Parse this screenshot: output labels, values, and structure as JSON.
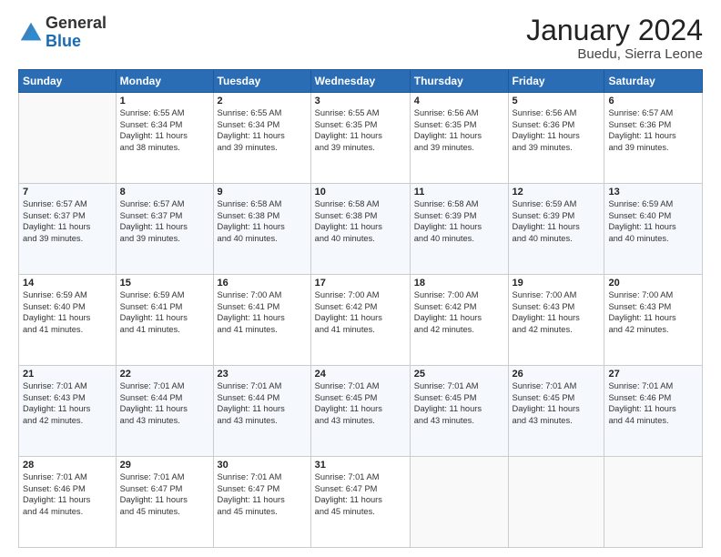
{
  "header": {
    "logo_general": "General",
    "logo_blue": "Blue",
    "title": "January 2024",
    "location": "Buedu, Sierra Leone"
  },
  "calendar": {
    "days_of_week": [
      "Sunday",
      "Monday",
      "Tuesday",
      "Wednesday",
      "Thursday",
      "Friday",
      "Saturday"
    ],
    "weeks": [
      [
        {
          "day": "",
          "info": ""
        },
        {
          "day": "1",
          "info": "Sunrise: 6:55 AM\nSunset: 6:34 PM\nDaylight: 11 hours\nand 38 minutes."
        },
        {
          "day": "2",
          "info": "Sunrise: 6:55 AM\nSunset: 6:34 PM\nDaylight: 11 hours\nand 39 minutes."
        },
        {
          "day": "3",
          "info": "Sunrise: 6:55 AM\nSunset: 6:35 PM\nDaylight: 11 hours\nand 39 minutes."
        },
        {
          "day": "4",
          "info": "Sunrise: 6:56 AM\nSunset: 6:35 PM\nDaylight: 11 hours\nand 39 minutes."
        },
        {
          "day": "5",
          "info": "Sunrise: 6:56 AM\nSunset: 6:36 PM\nDaylight: 11 hours\nand 39 minutes."
        },
        {
          "day": "6",
          "info": "Sunrise: 6:57 AM\nSunset: 6:36 PM\nDaylight: 11 hours\nand 39 minutes."
        }
      ],
      [
        {
          "day": "7",
          "info": "Sunrise: 6:57 AM\nSunset: 6:37 PM\nDaylight: 11 hours\nand 39 minutes."
        },
        {
          "day": "8",
          "info": "Sunrise: 6:57 AM\nSunset: 6:37 PM\nDaylight: 11 hours\nand 39 minutes."
        },
        {
          "day": "9",
          "info": "Sunrise: 6:58 AM\nSunset: 6:38 PM\nDaylight: 11 hours\nand 40 minutes."
        },
        {
          "day": "10",
          "info": "Sunrise: 6:58 AM\nSunset: 6:38 PM\nDaylight: 11 hours\nand 40 minutes."
        },
        {
          "day": "11",
          "info": "Sunrise: 6:58 AM\nSunset: 6:39 PM\nDaylight: 11 hours\nand 40 minutes."
        },
        {
          "day": "12",
          "info": "Sunrise: 6:59 AM\nSunset: 6:39 PM\nDaylight: 11 hours\nand 40 minutes."
        },
        {
          "day": "13",
          "info": "Sunrise: 6:59 AM\nSunset: 6:40 PM\nDaylight: 11 hours\nand 40 minutes."
        }
      ],
      [
        {
          "day": "14",
          "info": "Sunrise: 6:59 AM\nSunset: 6:40 PM\nDaylight: 11 hours\nand 41 minutes."
        },
        {
          "day": "15",
          "info": "Sunrise: 6:59 AM\nSunset: 6:41 PM\nDaylight: 11 hours\nand 41 minutes."
        },
        {
          "day": "16",
          "info": "Sunrise: 7:00 AM\nSunset: 6:41 PM\nDaylight: 11 hours\nand 41 minutes."
        },
        {
          "day": "17",
          "info": "Sunrise: 7:00 AM\nSunset: 6:42 PM\nDaylight: 11 hours\nand 41 minutes."
        },
        {
          "day": "18",
          "info": "Sunrise: 7:00 AM\nSunset: 6:42 PM\nDaylight: 11 hours\nand 42 minutes."
        },
        {
          "day": "19",
          "info": "Sunrise: 7:00 AM\nSunset: 6:43 PM\nDaylight: 11 hours\nand 42 minutes."
        },
        {
          "day": "20",
          "info": "Sunrise: 7:00 AM\nSunset: 6:43 PM\nDaylight: 11 hours\nand 42 minutes."
        }
      ],
      [
        {
          "day": "21",
          "info": "Sunrise: 7:01 AM\nSunset: 6:43 PM\nDaylight: 11 hours\nand 42 minutes."
        },
        {
          "day": "22",
          "info": "Sunrise: 7:01 AM\nSunset: 6:44 PM\nDaylight: 11 hours\nand 43 minutes."
        },
        {
          "day": "23",
          "info": "Sunrise: 7:01 AM\nSunset: 6:44 PM\nDaylight: 11 hours\nand 43 minutes."
        },
        {
          "day": "24",
          "info": "Sunrise: 7:01 AM\nSunset: 6:45 PM\nDaylight: 11 hours\nand 43 minutes."
        },
        {
          "day": "25",
          "info": "Sunrise: 7:01 AM\nSunset: 6:45 PM\nDaylight: 11 hours\nand 43 minutes."
        },
        {
          "day": "26",
          "info": "Sunrise: 7:01 AM\nSunset: 6:45 PM\nDaylight: 11 hours\nand 43 minutes."
        },
        {
          "day": "27",
          "info": "Sunrise: 7:01 AM\nSunset: 6:46 PM\nDaylight: 11 hours\nand 44 minutes."
        }
      ],
      [
        {
          "day": "28",
          "info": "Sunrise: 7:01 AM\nSunset: 6:46 PM\nDaylight: 11 hours\nand 44 minutes."
        },
        {
          "day": "29",
          "info": "Sunrise: 7:01 AM\nSunset: 6:47 PM\nDaylight: 11 hours\nand 45 minutes."
        },
        {
          "day": "30",
          "info": "Sunrise: 7:01 AM\nSunset: 6:47 PM\nDaylight: 11 hours\nand 45 minutes."
        },
        {
          "day": "31",
          "info": "Sunrise: 7:01 AM\nSunset: 6:47 PM\nDaylight: 11 hours\nand 45 minutes."
        },
        {
          "day": "",
          "info": ""
        },
        {
          "day": "",
          "info": ""
        },
        {
          "day": "",
          "info": ""
        }
      ]
    ]
  }
}
